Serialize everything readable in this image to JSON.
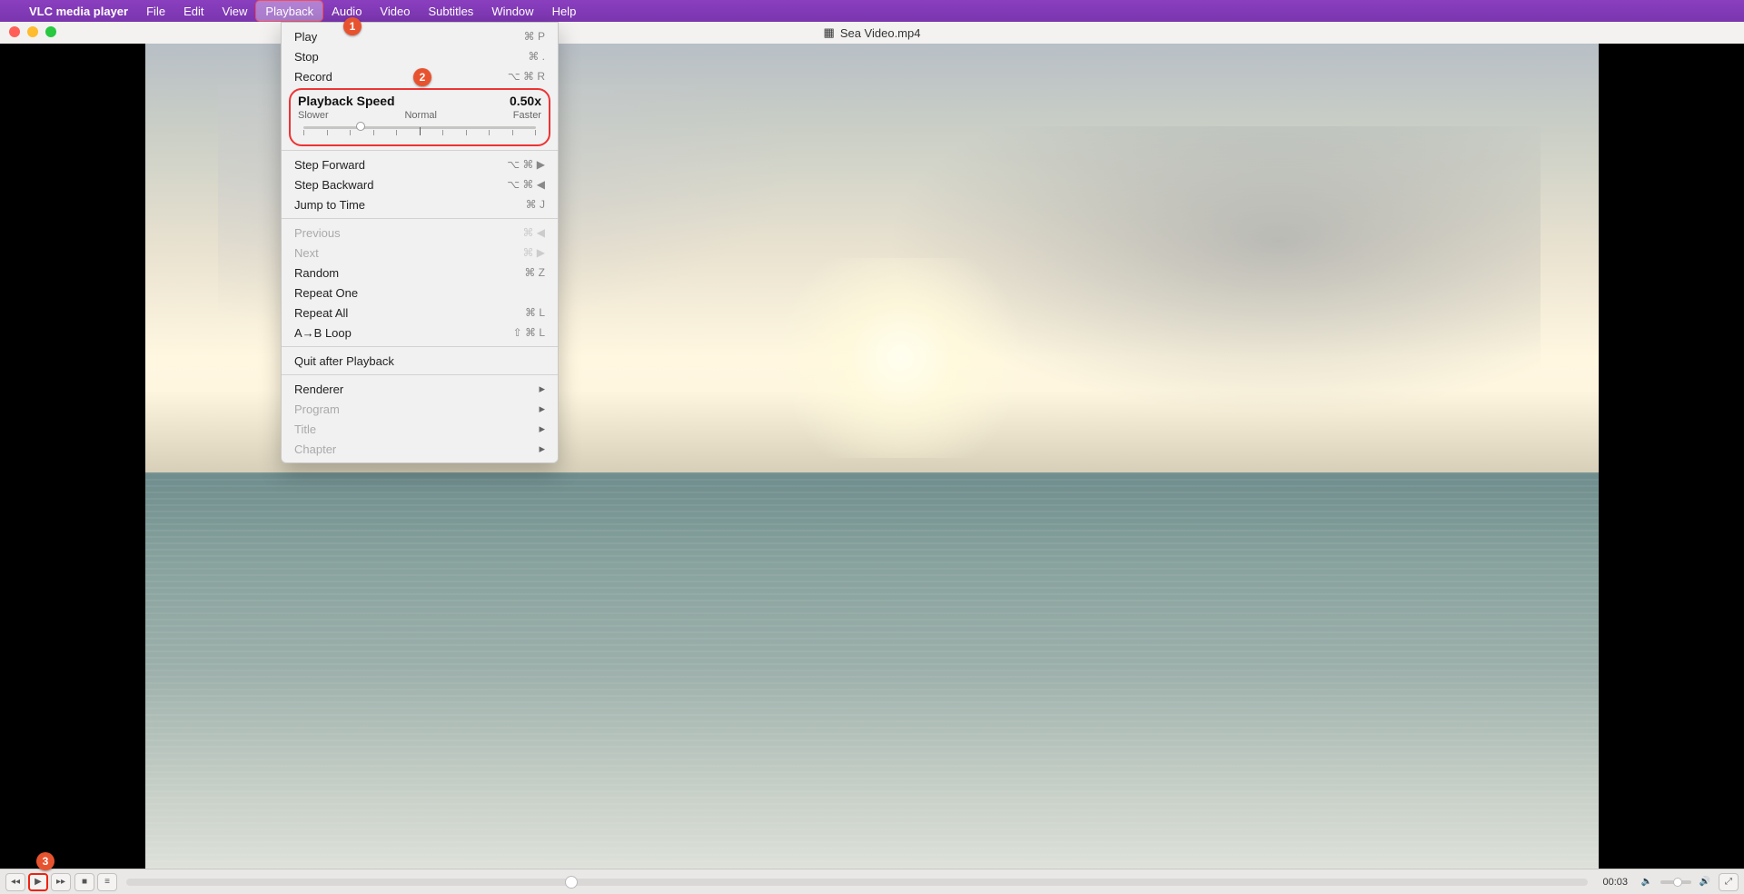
{
  "menubar": {
    "app_name": "VLC media player",
    "items": [
      "File",
      "Edit",
      "View",
      "Playback",
      "Audio",
      "Video",
      "Subtitles",
      "Window",
      "Help"
    ],
    "active_index": 3
  },
  "window": {
    "title": "Sea Video.mp4"
  },
  "dropdown": {
    "play": "Play",
    "play_sc": "⌘ P",
    "stop": "Stop",
    "stop_sc": "⌘ .",
    "record": "Record",
    "record_sc": "⌥ ⌘ R",
    "speed_label": "Playback Speed",
    "speed_value": "0.50x",
    "slower": "Slower",
    "normal": "Normal",
    "faster": "Faster",
    "step_forward": "Step Forward",
    "step_forward_sc": "⌥ ⌘ ▶",
    "step_backward": "Step Backward",
    "step_backward_sc": "⌥ ⌘ ◀",
    "jump_to_time": "Jump to Time",
    "jump_to_time_sc": "⌘ J",
    "previous": "Previous",
    "previous_sc": "⌘ ◀",
    "next": "Next",
    "next_sc": "⌘ ▶",
    "random": "Random",
    "random_sc": "⌘ Z",
    "repeat_one": "Repeat One",
    "repeat_all": "Repeat All",
    "repeat_all_sc": "⌘ L",
    "ab_loop": "A→B Loop",
    "ab_loop_sc": "⇧ ⌘ L",
    "quit_after": "Quit after Playback",
    "renderer": "Renderer",
    "program": "Program",
    "title": "Title",
    "chapter": "Chapter"
  },
  "toolbar": {
    "time": "00:03"
  },
  "annotations": {
    "b1": "1",
    "b2": "2",
    "b3": "3"
  }
}
